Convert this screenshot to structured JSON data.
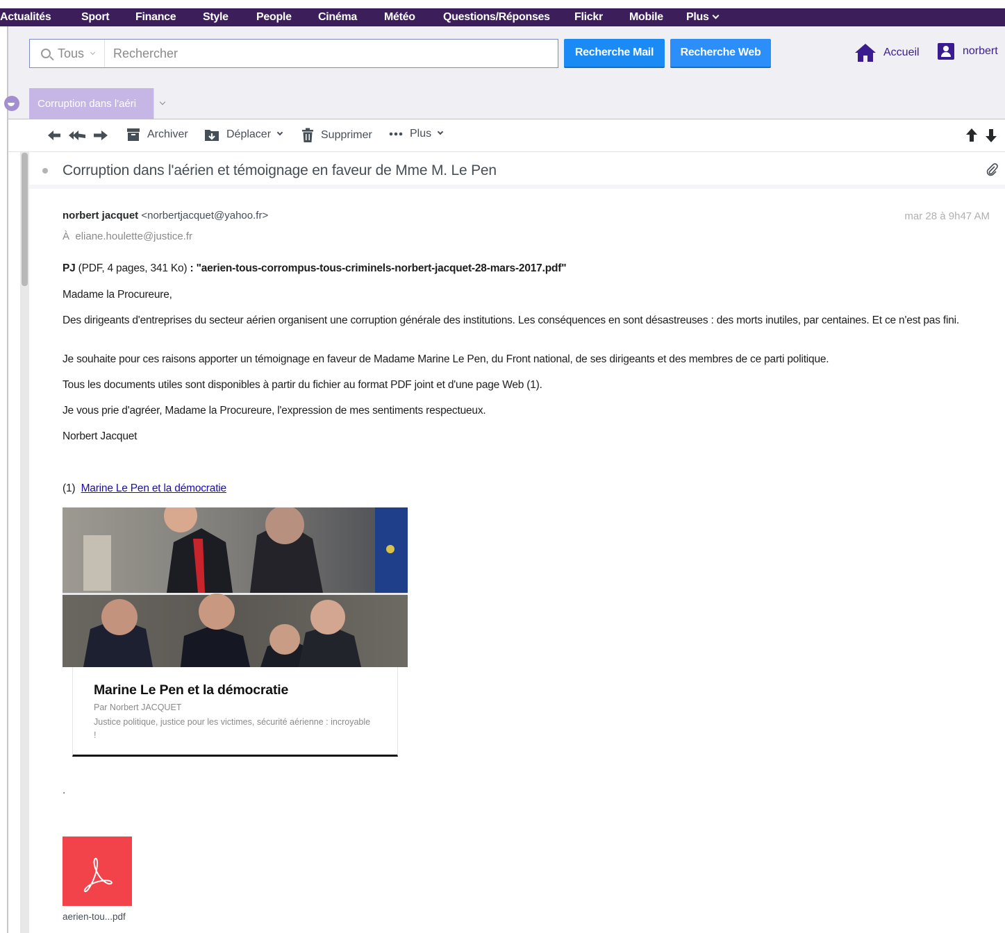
{
  "topnav": [
    {
      "label": "Actualités"
    },
    {
      "label": "Sport"
    },
    {
      "label": "Finance"
    },
    {
      "label": "Style"
    },
    {
      "label": "People"
    },
    {
      "label": "Cinéma"
    },
    {
      "label": "Météo"
    },
    {
      "label": "Questions/Réponses"
    },
    {
      "label": "Flickr"
    },
    {
      "label": "Mobile"
    },
    {
      "label": "Plus"
    }
  ],
  "search": {
    "scope": "Tous",
    "placeholder": "Rechercher",
    "value": "",
    "mail_button": "Recherche Mail",
    "web_button": "Recherche Web"
  },
  "header": {
    "home_label": "Accueil",
    "user_label": "norbert"
  },
  "tab": {
    "label": "Corruption dans l'aéri"
  },
  "toolbar": {
    "archive": "Archiver",
    "move": "Déplacer",
    "delete": "Supprimer",
    "more": "Plus"
  },
  "message": {
    "subject": "Corruption dans l'aérien et témoignage en faveur de Mme M. Le Pen",
    "from_name": "norbert jacquet",
    "from_email": "<norbertjacquet@yahoo.fr>",
    "date": "mar 28 à 9h47 AM",
    "to_prefix": "À",
    "to": "eliane.houlette@justice.fr",
    "attachment_prefix": "PJ",
    "attachment_meta": " (PDF, 4 pages, 341 Ko) ",
    "attachment_title": ": \"aerien-tous-corrompus-tous-criminels-norbert-jacquet-28-mars-2017.pdf\"",
    "greeting": "Madame la Procureure,",
    "p1": "Des dirigeants d'entreprises du secteur aérien organisent une corruption générale des institutions. Les conséquences en sont désastreuses : des morts inutiles, par centaines. Et ce n'est pas fini.",
    "p2": "Je souhaite pour ces raisons apporter un témoignage en faveur de Madame Marine Le Pen, du Front national, de ses dirigeants et des membres de ce parti politique.",
    "p3": "Tous les documents utiles sont disponibles à partir du fichier au format PDF joint et d'une page Web (1).",
    "p4": "Je vous prie d'agréer, Madame la Procureure, l'expression de mes sentiments respectueux.",
    "signature": "Norbert Jacquet",
    "footnote_prefix": "(1) ",
    "footnote_link": "Marine Le Pen et la démocratie",
    "trailing_dot": "."
  },
  "preview_card": {
    "title": "Marine Le Pen et la démocratie",
    "author": "Par Norbert JACQUET",
    "description": "Justice politique, justice pour les victimes, sécurité aérienne : incroyable !"
  },
  "attachment": {
    "filename": "aerien-tou...pdf"
  },
  "colors": {
    "nav_bg": "#3c1f5a",
    "accent_purple": "#3a1c8f",
    "button_blue": "#1a8bf5",
    "tab_bg": "#c5b6e6",
    "pdf_red": "#f2434b"
  }
}
